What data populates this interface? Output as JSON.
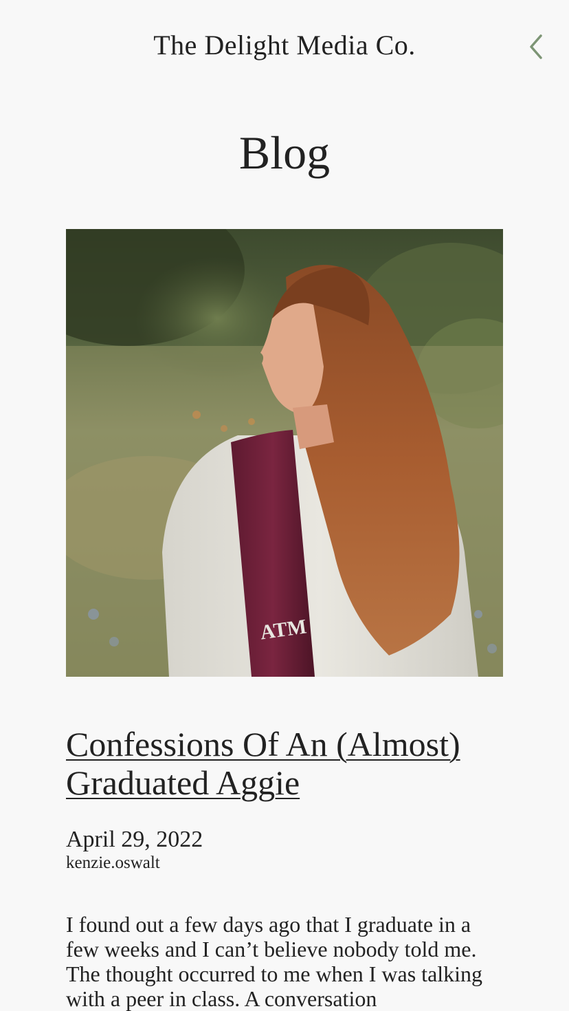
{
  "header": {
    "site_title": "The Delight Media Co.",
    "back_icon": "chevron-left-icon",
    "accent_color": "#7d9575"
  },
  "page": {
    "heading": "Blog"
  },
  "post": {
    "image_alt": "Portrait of a graduate with long auburn hair wearing a maroon Texas A&M stole in a meadow",
    "stole_logo": "ATM",
    "title": "Confessions Of An (Almost) Graduated Aggie",
    "date": "April 29, 2022",
    "author": "kenzie.oswalt",
    "excerpt": "I found out a few days ago that I graduate in a few weeks and I can’t believe nobody told me. The thought occurred to me when I was talking with a peer in class. A conversation"
  }
}
